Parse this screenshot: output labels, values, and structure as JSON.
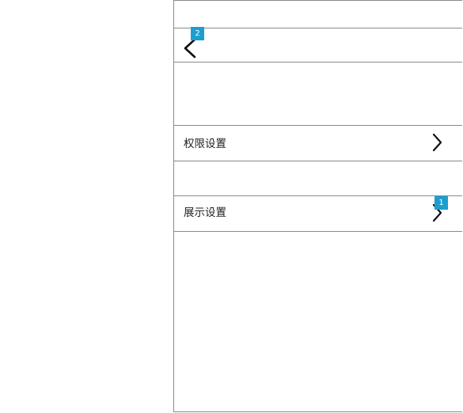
{
  "nav": {
    "back_icon": "chevron-left-icon",
    "badge": "2"
  },
  "settings": [
    {
      "label": "权限设置",
      "icon": "chevron-right-icon"
    },
    {
      "label": "展示设置",
      "icon": "chevron-right-icon",
      "badge": "1"
    }
  ],
  "colors": {
    "badge_bg": "#1a9fd0",
    "divider": "#8a8a8a",
    "text": "#222222"
  }
}
